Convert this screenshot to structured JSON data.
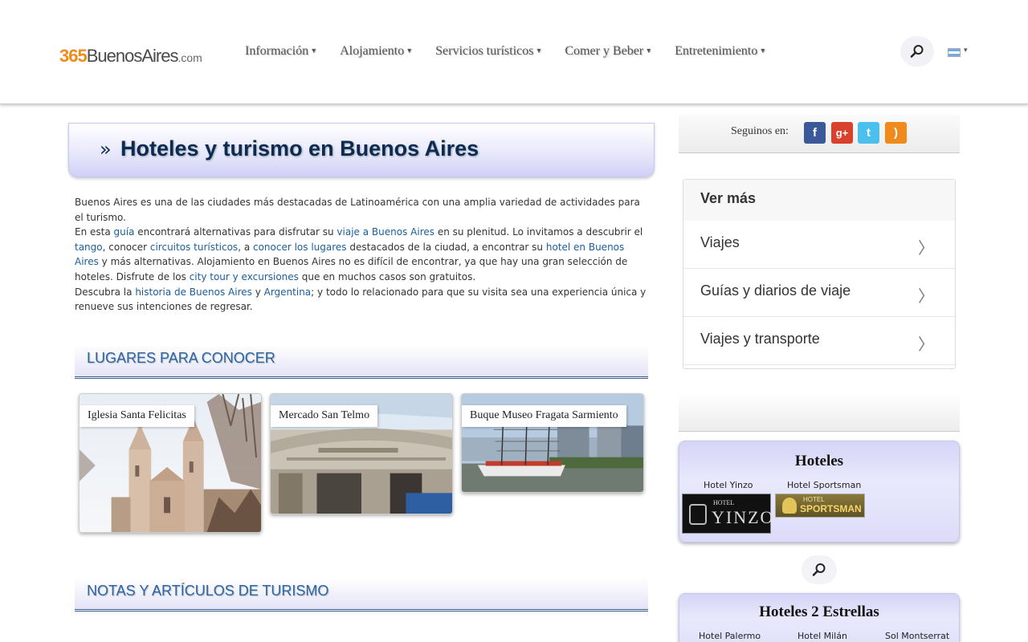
{
  "header": {
    "logo_num": "365",
    "logo_name": "BuenosAires",
    "logo_tld": ".com",
    "nav": [
      "Información",
      "Alojamiento",
      "Servicios turísticos",
      "Comer y Beber",
      "Entretenimiento"
    ],
    "caret": "▾"
  },
  "main": {
    "title_marker": "»",
    "title": "Hoteles y turismo en Buenos Aires",
    "intro": {
      "p1": "Buenos Aires es una de las ciudades más destacadas de Latinoamérica con una amplia variedad de actividades para el turismo.",
      "p2a": "En esta ",
      "l_guia": "guía",
      "p2b": " encontrará alternativas para disfrutar su ",
      "l_viaje": "viaje a Buenos Aires",
      "p2c": " en su plenitud. Lo invitamos a descubrir el ",
      "l_tango": "tango",
      "p2d": ", conocer ",
      "l_circuitos": "circuitos turísticos",
      "p2e": ", a ",
      "l_conocer": "conocer los lugares",
      "p2f": " destacados de la ciudad, a encontrar su ",
      "l_hotel": "hotel en Buenos Aires",
      "p2g": " y más alternativas. Alojamiento en Buenos Aires no es difícil de encontrar, ya que hay una gran selección de hoteles. Disfrute de los ",
      "l_city": "city tour y excursiones",
      "p2h": " que en muchos casos son gratuitos.",
      "p3a": "Descubra la ",
      "l_historia": "historia de Buenos Aires",
      "p3b": " y ",
      "l_argentina": "Argentina",
      "p3c": "; y todo lo relacionado para que su visita sea una experiencia única y renueve sus intenciones de regresar."
    },
    "section_places": "LUGARES PARA CONOCER",
    "places": [
      "Iglesia Santa Felicitas",
      "Mercado San Telmo",
      "Buque Museo Fragata Sarmiento"
    ],
    "section_notes": "NOTAS Y ARTÍCULOS DE TURISMO"
  },
  "sidebar": {
    "follow_label": "Seguinos en:",
    "social": [
      {
        "icon": "facebook-icon",
        "glyph": "f",
        "color": "#3b5998"
      },
      {
        "icon": "google-plus-icon",
        "glyph": "g+",
        "color": "#d9412c"
      },
      {
        "icon": "twitter-icon",
        "glyph": "t",
        "color": "#4cc0ec"
      },
      {
        "icon": "rss-icon",
        "glyph": ")",
        "color": "#f08a1c"
      }
    ],
    "ver_mas": {
      "title": "Ver más",
      "items": [
        "Viajes",
        "Guías y diarios de viaje",
        "Viajes y transporte"
      ],
      "chevron": "〉"
    },
    "hoteles": {
      "title": "Hoteles",
      "names": [
        "Hotel Yinzo",
        "Hotel Sportsman"
      ],
      "logo_yinzo_a": "HOTEL",
      "logo_yinzo_b": "YINZO",
      "logo_sportsman_a": "HOTEL",
      "logo_sportsman_b": "SPORTSMAN"
    },
    "hoteles2": {
      "title": "Hoteles 2 Estrellas",
      "names": [
        "Hotel Palermo",
        "Hotel Milán",
        "Sol Montserrat"
      ]
    }
  }
}
